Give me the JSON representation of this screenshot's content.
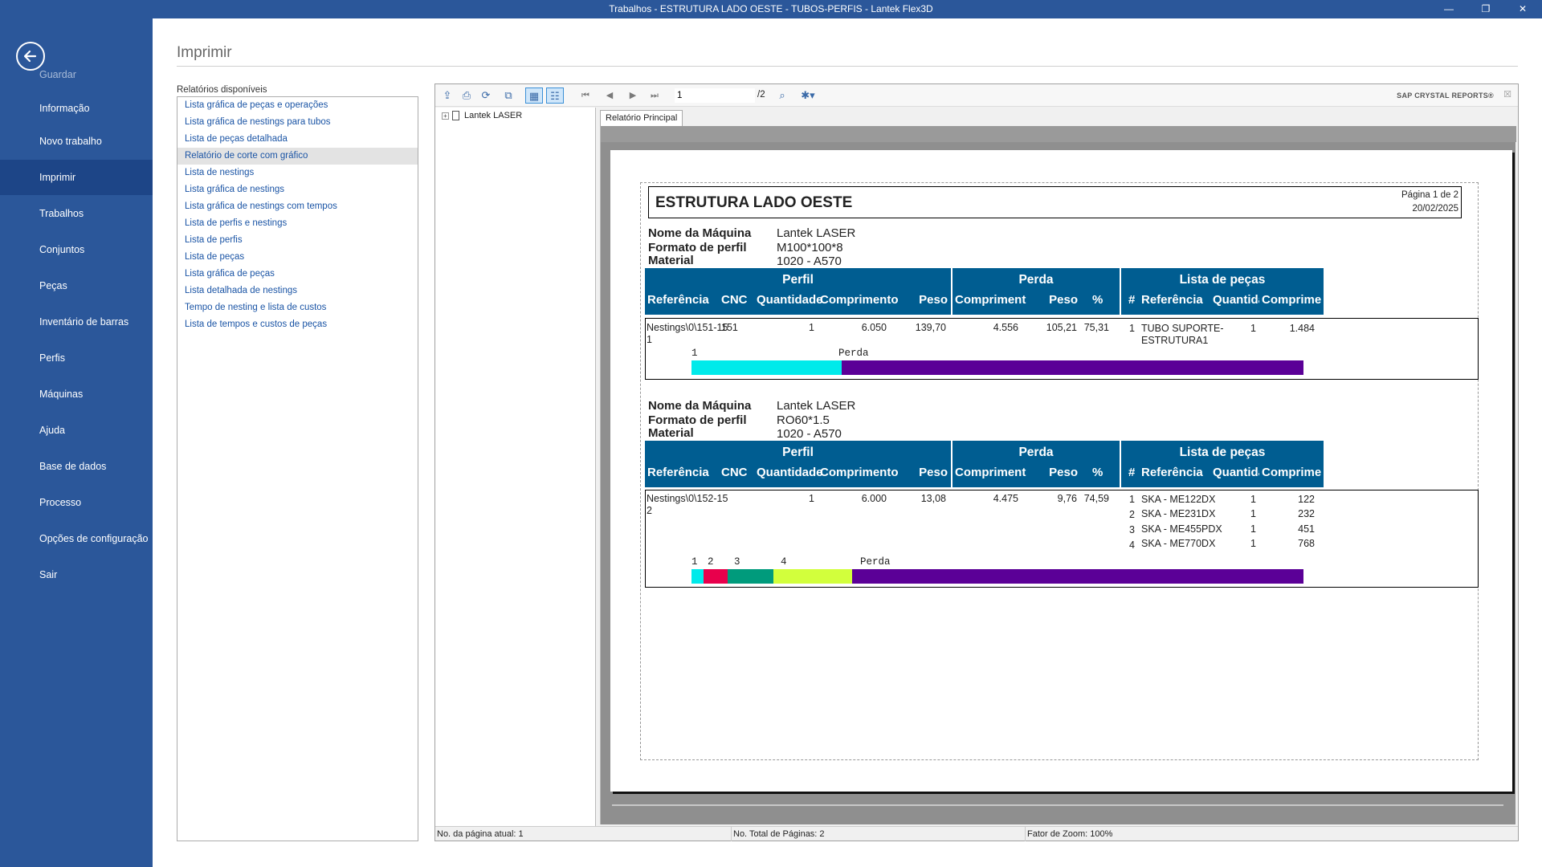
{
  "window": {
    "title": "Trabalhos - ESTRUTURA LADO OESTE - TUBOS-PERFIS - Lantek Flex3D",
    "controls": [
      "—",
      "❐",
      "✕"
    ]
  },
  "sidebar": {
    "items": [
      {
        "label": "Guardar"
      },
      {
        "label": "Informação"
      },
      {
        "label": "Novo trabalho"
      },
      {
        "label": "Imprimir"
      },
      {
        "label": "Trabalhos"
      },
      {
        "label": "Conjuntos"
      },
      {
        "label": "Peças"
      },
      {
        "label": "Inventário de barras"
      },
      {
        "label": "Perfis"
      },
      {
        "label": "Máquinas"
      },
      {
        "label": "Ajuda"
      },
      {
        "label": "Base de dados"
      },
      {
        "label": "Processo"
      },
      {
        "label": "Opções de configuração"
      },
      {
        "label": "Sair"
      }
    ],
    "active": "Imprimir",
    "accent": "#2b579a"
  },
  "main": {
    "title": "Imprimir",
    "reports_label": "Relatórios disponíveis",
    "reports": [
      "Lista gráfica de peças e operações",
      "Lista gráfica de nestings para tubos",
      "Lista de peças detalhada",
      "Relatório de corte com gráfico",
      "Lista de nestings",
      "Lista gráfica de nestings",
      "Lista gráfica de nestings com tempos",
      "Lista de perfis e nestings",
      "Lista de perfis",
      "Lista de peças",
      "Lista gráfica de peças",
      "Lista detalhada de nestings",
      "Tempo de nesting e lista de custos",
      "Lista de tempos e custos de peças"
    ],
    "selected_report": "Relatório de corte com gráfico"
  },
  "viewer": {
    "page_input": "1",
    "page_total": "/2",
    "brand": "SAP CRYSTAL REPORTS®",
    "tree_root": "Lantek LASER",
    "tab": "Relatório Principal",
    "status": {
      "current_page": "No. da página atual: 1",
      "total_pages": "No. Total de Páginas: 2",
      "zoom": "Fator de Zoom: 100%"
    }
  },
  "report": {
    "title": "ESTRUTURA LADO OESTE",
    "page_info": "Página 1 de 2",
    "date": "20/02/2025",
    "labels": {
      "machine": "Nome da Máquina",
      "profile": "Formato de perfil",
      "material": "Material"
    },
    "band_titles": {
      "perfil": "Perfil",
      "perda": "Perda",
      "pecas": "Lista de peças"
    },
    "columns": {
      "referencia": "Referência",
      "cnc": "CNC",
      "quantidade": "Quantidade",
      "comprimento": "Comprimento",
      "peso": "Peso",
      "perda_comprimento": "Compriment",
      "perda_peso": "Peso",
      "perda_pct": "%",
      "num": "#",
      "peca_referencia": "Referência",
      "peca_quantidade": "Quantida",
      "peca_comprimento": "Comprimen"
    },
    "waste_label": "Perda",
    "groups": [
      {
        "machine": "Lantek LASER",
        "profile": "M100*100*8",
        "material": "1020 - A570",
        "nesting": {
          "ref_line1": "Nestings\\0\\151-15",
          "ref_line2": "1",
          "cnc": "151",
          "quantity": "1",
          "length": "6.050",
          "weight": "139,70",
          "waste_length": "4.556",
          "waste_weight": "105,21",
          "waste_pct": "75,31"
        },
        "parts": [
          {
            "num": "1",
            "ref_line1": "TUBO SUPORTE-",
            "ref_line2": "ESTRUTURA1",
            "qty": "1",
            "length": "1.484"
          }
        ],
        "bar_labels": [
          "1"
        ],
        "bar": [
          {
            "label": "1",
            "fraction": 0.245,
            "color": "#00eaea"
          },
          {
            "label": "Perda",
            "fraction": 0.755,
            "color": "#5b0097"
          }
        ]
      },
      {
        "machine": "Lantek LASER",
        "profile": "RO60*1.5",
        "material": "1020 - A570",
        "nesting": {
          "ref_line1": "Nestings\\0\\152-15",
          "ref_line2": "2",
          "cnc": "",
          "quantity": "1",
          "length": "6.000",
          "weight": "13,08",
          "waste_length": "4.475",
          "waste_weight": "9,76",
          "waste_pct": "74,59"
        },
        "parts": [
          {
            "num": "1",
            "ref_line1": "SKA - ME122DX",
            "ref_line2": "",
            "qty": "1",
            "length": "122"
          },
          {
            "num": "2",
            "ref_line1": "SKA - ME231DX",
            "ref_line2": "",
            "qty": "1",
            "length": "232"
          },
          {
            "num": "3",
            "ref_line1": "SKA - ME455PDX",
            "ref_line2": "",
            "qty": "1",
            "length": "451"
          },
          {
            "num": "4",
            "ref_line1": "SKA - ME770DX",
            "ref_line2": "",
            "qty": "1",
            "length": "768"
          }
        ],
        "bar_labels": [
          "1",
          "2",
          "3",
          "4"
        ],
        "bar": [
          {
            "label": "1",
            "fraction": 0.02,
            "color": "#00eaea"
          },
          {
            "label": "2",
            "fraction": 0.039,
            "color": "#e8004c"
          },
          {
            "label": "3",
            "fraction": 0.075,
            "color": "#009b7c"
          },
          {
            "label": "4",
            "fraction": 0.128,
            "color": "#d2ff3c"
          },
          {
            "label": "Perda",
            "fraction": 0.738,
            "color": "#5b0097"
          }
        ]
      }
    ]
  }
}
